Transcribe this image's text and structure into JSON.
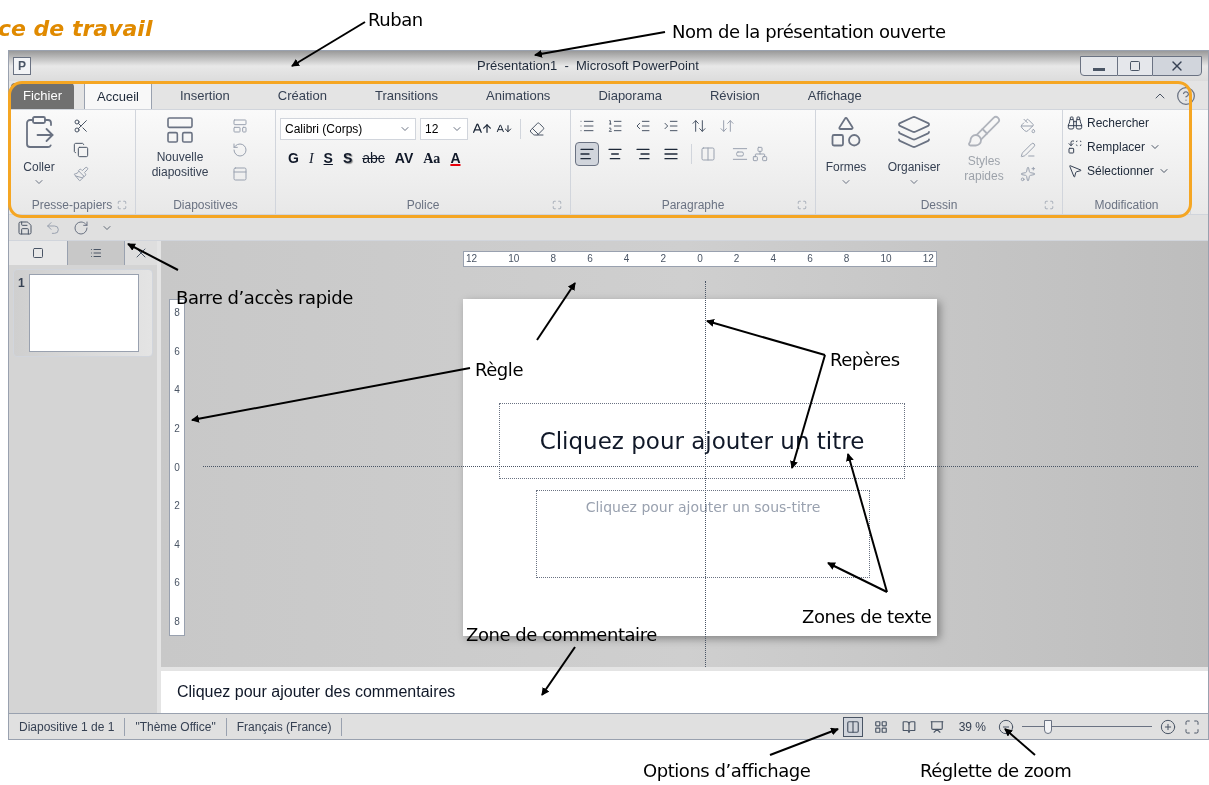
{
  "heading": "ce de travail",
  "window": {
    "app_icon": "P",
    "title": "Présentation1  -  Microsoft PowerPoint"
  },
  "tabs": [
    {
      "label": "Fichier",
      "kind": "file",
      "selected": false
    },
    {
      "label": "Accueil",
      "kind": "tab",
      "selected": true
    },
    {
      "label": "Insertion",
      "kind": "tab",
      "selected": false
    },
    {
      "label": "Création",
      "kind": "tab",
      "selected": false
    },
    {
      "label": "Transitions",
      "kind": "tab",
      "selected": false
    },
    {
      "label": "Animations",
      "kind": "tab",
      "selected": false
    },
    {
      "label": "Diaporama",
      "kind": "tab",
      "selected": false
    },
    {
      "label": "Révision",
      "kind": "tab",
      "selected": false
    },
    {
      "label": "Affichage",
      "kind": "tab",
      "selected": false
    }
  ],
  "ribbon_groups": [
    {
      "kind": "clipboard",
      "label": "Presse-papiers",
      "paste": "Coller"
    },
    {
      "kind": "slides",
      "label": "Diapositives",
      "new_slide": "Nouvelle diapositive"
    },
    {
      "kind": "font",
      "label": "Police",
      "font": "Calibri (Corps)",
      "size": "12",
      "format_buttons": [
        {
          "label": "G",
          "kind": "bold"
        },
        {
          "label": "I",
          "kind": "italic"
        },
        {
          "label": "S",
          "kind": "underline"
        },
        {
          "label": "S",
          "kind": "shadow"
        },
        {
          "label": "abc",
          "kind": "strike"
        },
        {
          "label": "AV",
          "kind": "spacing"
        },
        {
          "label": "Aa",
          "kind": "case"
        },
        {
          "label": "A",
          "kind": "color"
        }
      ]
    },
    {
      "kind": "paragraph",
      "label": "Paragraphe",
      "alignments": [
        {
          "kind": "left",
          "selected": true
        },
        {
          "kind": "center",
          "selected": false
        },
        {
          "kind": "right",
          "selected": false
        },
        {
          "kind": "justify",
          "selected": false
        }
      ]
    },
    {
      "kind": "drawing",
      "label": "Dessin",
      "shapes": "Formes",
      "arrange": "Organiser",
      "quick_styles": {
        "label": "Styles rapides",
        "disabled": true
      }
    },
    {
      "kind": "editing",
      "label": "Modification",
      "commands": [
        {
          "label": "Rechercher",
          "kind": "find",
          "dropdown": false
        },
        {
          "label": "Remplacer",
          "kind": "replace",
          "dropdown": true
        },
        {
          "label": "Sélectionner",
          "kind": "select",
          "dropdown": true
        }
      ]
    }
  ],
  "panel_tabs": [
    {
      "kind": "slides",
      "selected": true
    },
    {
      "kind": "outline",
      "selected": false
    }
  ],
  "thumbnails": [
    {
      "number": "1"
    }
  ],
  "horizontal_ruler": [
    "12",
    "10",
    "8",
    "6",
    "4",
    "2",
    "0",
    "2",
    "4",
    "6",
    "8",
    "10",
    "12"
  ],
  "vertical_ruler": [
    "8",
    "6",
    "4",
    "2",
    "0",
    "2",
    "4",
    "6",
    "8"
  ],
  "slide": {
    "title_placeholder": "Cliquez pour ajouter un titre",
    "subtitle_placeholder": "Cliquez pour ajouter un sous-titre"
  },
  "notes": {
    "placeholder": "Cliquez pour ajouter des commentaires"
  },
  "status_bar": {
    "items": [
      "Diapositive 1 de 1",
      "\"Thème Office\"",
      "Français (France)"
    ],
    "views": [
      {
        "kind": "normal",
        "selected": true
      },
      {
        "kind": "sorter",
        "selected": false
      },
      {
        "kind": "reading",
        "selected": false
      },
      {
        "kind": "slideshow",
        "selected": false
      }
    ],
    "zoom": "39 %",
    "zoom_slider": {
      "level": 0.2
    }
  },
  "annotations": [
    "Ruban",
    "Nom de la présentation ouverte",
    "Barre d’accès rapide",
    "Règle",
    "Repères",
    "Zones de texte",
    "Zone de commentaire",
    "Options d’affichage",
    "Réglette de zoom"
  ]
}
